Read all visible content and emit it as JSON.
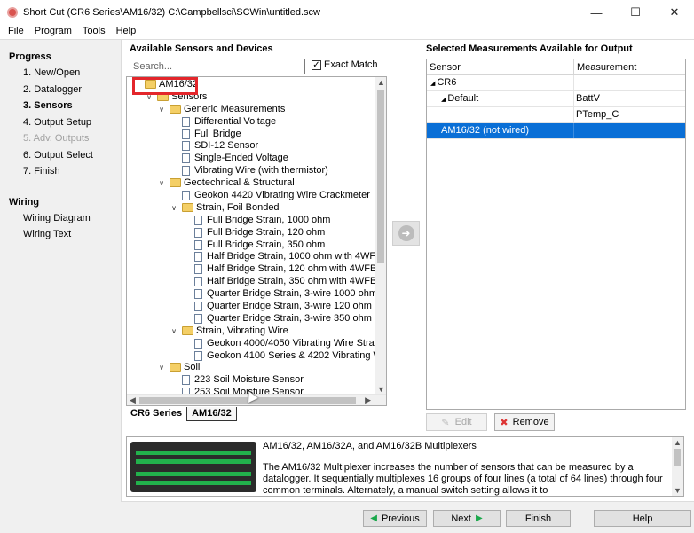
{
  "window": {
    "title": "Short Cut (CR6 Series\\AM16/32) C:\\Campbellsci\\SCWin\\untitled.scw"
  },
  "menu": [
    "File",
    "Program",
    "Tools",
    "Help"
  ],
  "nav": {
    "progress_heading": "Progress",
    "steps": [
      "1. New/Open",
      "2. Datalogger",
      "3. Sensors",
      "4. Output Setup",
      "5. Adv. Outputs",
      "6. Output Select",
      "7. Finish"
    ],
    "wiring_heading": "Wiring",
    "wiring_items": [
      "Wiring Diagram",
      "Wiring Text"
    ]
  },
  "available": {
    "title": "Available Sensors and Devices",
    "search_placeholder": "Search...",
    "exact_match_label": "Exact Match",
    "exact_match_checked": true
  },
  "tree": [
    {
      "label": "AM16/32",
      "level": 0,
      "type": "folder",
      "expander": ""
    },
    {
      "label": "Sensors",
      "level": 1,
      "type": "folder",
      "expander": "open"
    },
    {
      "label": "Generic Measurements",
      "level": 2,
      "type": "folder",
      "expander": "open"
    },
    {
      "label": "Differential Voltage",
      "level": 3,
      "type": "file"
    },
    {
      "label": "Full Bridge",
      "level": 3,
      "type": "file"
    },
    {
      "label": "SDI-12 Sensor",
      "level": 3,
      "type": "file"
    },
    {
      "label": "Single-Ended Voltage",
      "level": 3,
      "type": "file"
    },
    {
      "label": "Vibrating Wire (with thermistor)",
      "level": 3,
      "type": "file"
    },
    {
      "label": "Geotechnical & Structural",
      "level": 2,
      "type": "folder",
      "expander": "open"
    },
    {
      "label": "Geokon 4420 Vibrating Wire Crackmeter",
      "level": 3,
      "type": "file"
    },
    {
      "label": "Strain, Foil Bonded",
      "level": 3,
      "type": "folder",
      "expander": "open"
    },
    {
      "label": "Full Bridge Strain, 1000 ohm",
      "level": 4,
      "type": "file"
    },
    {
      "label": "Full Bridge Strain, 120 ohm",
      "level": 4,
      "type": "file"
    },
    {
      "label": "Full Bridge Strain, 350 ohm",
      "level": 4,
      "type": "file"
    },
    {
      "label": "Half Bridge Strain, 1000 ohm with 4WF",
      "level": 4,
      "type": "file"
    },
    {
      "label": "Half Bridge Strain, 120 ohm with 4WFB",
      "level": 4,
      "type": "file"
    },
    {
      "label": "Half Bridge Strain, 350 ohm with 4WFB",
      "level": 4,
      "type": "file"
    },
    {
      "label": "Quarter Bridge Strain, 3-wire 1000 ohm",
      "level": 4,
      "type": "file"
    },
    {
      "label": "Quarter Bridge Strain, 3-wire 120 ohm",
      "level": 4,
      "type": "file"
    },
    {
      "label": "Quarter Bridge Strain, 3-wire 350 ohm",
      "level": 4,
      "type": "file"
    },
    {
      "label": "Strain, Vibrating Wire",
      "level": 3,
      "type": "folder",
      "expander": "open"
    },
    {
      "label": "Geokon 4000/4050 Vibrating Wire Strai",
      "level": 4,
      "type": "file"
    },
    {
      "label": "Geokon 4100 Series & 4202 Vibrating W",
      "level": 4,
      "type": "file"
    },
    {
      "label": "Soil",
      "level": 2,
      "type": "folder",
      "expander": "open"
    },
    {
      "label": "223 Soil Moisture Sensor",
      "level": 3,
      "type": "file"
    },
    {
      "label": "253 Soil Moisture Sensor",
      "level": 3,
      "type": "file"
    }
  ],
  "tabs": [
    "CR6 Series",
    "AM16/32"
  ],
  "selected_tab": "AM16/32",
  "output": {
    "title": "Selected Measurements Available for Output",
    "col_sensor": "Sensor",
    "col_measurement": "Measurement",
    "rows": [
      {
        "sensor": "CR6",
        "measurement": "",
        "indent": 0,
        "expander": "down"
      },
      {
        "sensor": "Default",
        "measurement": "BattV",
        "indent": 1,
        "expander": "down"
      },
      {
        "sensor": "",
        "measurement": "PTemp_C",
        "indent": 2,
        "expander": ""
      },
      {
        "sensor": "AM16/32 (not wired)",
        "measurement": "",
        "indent": 1,
        "expander": "",
        "selected": true
      }
    ]
  },
  "buttons": {
    "edit": "Edit",
    "remove": "Remove",
    "previous": "Previous",
    "next": "Next",
    "finish": "Finish",
    "help": "Help"
  },
  "info": {
    "heading": "AM16/32, AM16/32A, and AM16/32B Multiplexers",
    "body": "The AM16/32 Multiplexer increases the number of sensors that can be measured by a datalogger. It sequentially multiplexes 16 groups of four lines (a total of 64 lines) through four common terminals. Alternately, a manual switch setting allows it to"
  },
  "colors": {
    "selection": "#0a6fd6",
    "highlight_box": "#e3262b",
    "folder": "#f4cf66",
    "arrow": "#1aa84b"
  }
}
